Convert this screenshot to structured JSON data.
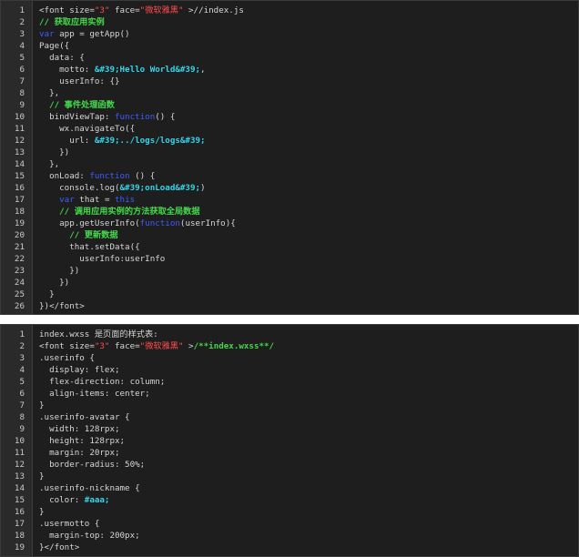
{
  "blocks": [
    {
      "id": "index-js",
      "lines": [
        {
          "n": "1",
          "tokens": [
            {
              "t": "<font size=",
              "c": "plain"
            },
            {
              "t": "\"3\"",
              "c": "str"
            },
            {
              "t": " face=",
              "c": "plain"
            },
            {
              "t": "\"微软雅黑\"",
              "c": "str"
            },
            {
              "t": " >//index.js",
              "c": "plain"
            }
          ]
        },
        {
          "n": "2",
          "tokens": [
            {
              "t": "// 获取应用实例",
              "c": "com"
            }
          ]
        },
        {
          "n": "3",
          "tokens": [
            {
              "t": "var",
              "c": "kw"
            },
            {
              "t": " app = getApp()",
              "c": "plain"
            }
          ]
        },
        {
          "n": "4",
          "tokens": [
            {
              "t": "Page({",
              "c": "plain"
            }
          ]
        },
        {
          "n": "5",
          "tokens": [
            {
              "t": "  data: {",
              "c": "plain"
            }
          ]
        },
        {
          "n": "6",
          "tokens": [
            {
              "t": "    motto: ",
              "c": "plain"
            },
            {
              "t": "&#39;Hello World&#39;",
              "c": "bstr"
            },
            {
              "t": ",",
              "c": "plain"
            }
          ]
        },
        {
          "n": "7",
          "tokens": [
            {
              "t": "    userInfo: {}",
              "c": "plain"
            }
          ]
        },
        {
          "n": "8",
          "tokens": [
            {
              "t": "  },",
              "c": "plain"
            }
          ]
        },
        {
          "n": "9",
          "tokens": [
            {
              "t": "  // 事件处理函数",
              "c": "com"
            }
          ]
        },
        {
          "n": "10",
          "tokens": [
            {
              "t": "  bindViewTap: ",
              "c": "plain"
            },
            {
              "t": "function",
              "c": "kw"
            },
            {
              "t": "() {",
              "c": "plain"
            }
          ]
        },
        {
          "n": "11",
          "tokens": [
            {
              "t": "    wx.navigateTo({",
              "c": "plain"
            }
          ]
        },
        {
          "n": "12",
          "tokens": [
            {
              "t": "      url: ",
              "c": "plain"
            },
            {
              "t": "&#39;../logs/logs&#39;",
              "c": "bstr"
            }
          ]
        },
        {
          "n": "13",
          "tokens": [
            {
              "t": "    })",
              "c": "plain"
            }
          ]
        },
        {
          "n": "14",
          "tokens": [
            {
              "t": "  },",
              "c": "plain"
            }
          ]
        },
        {
          "n": "15",
          "tokens": [
            {
              "t": "  onLoad: ",
              "c": "plain"
            },
            {
              "t": "function",
              "c": "kw"
            },
            {
              "t": " () {",
              "c": "plain"
            }
          ]
        },
        {
          "n": "16",
          "tokens": [
            {
              "t": "    console.log(",
              "c": "plain"
            },
            {
              "t": "&#39;onLoad&#39;",
              "c": "bstr"
            },
            {
              "t": ")",
              "c": "plain"
            }
          ]
        },
        {
          "n": "17",
          "tokens": [
            {
              "t": "    ",
              "c": "plain"
            },
            {
              "t": "var",
              "c": "kw"
            },
            {
              "t": " that = ",
              "c": "plain"
            },
            {
              "t": "this",
              "c": "kw"
            }
          ]
        },
        {
          "n": "18",
          "tokens": [
            {
              "t": "    // 调用应用实例的方法获取全局数据",
              "c": "com"
            }
          ]
        },
        {
          "n": "19",
          "tokens": [
            {
              "t": "    app.getUserInfo(",
              "c": "plain"
            },
            {
              "t": "function",
              "c": "kw"
            },
            {
              "t": "(userInfo){",
              "c": "plain"
            }
          ]
        },
        {
          "n": "20",
          "tokens": [
            {
              "t": "      // 更新数据",
              "c": "com"
            }
          ]
        },
        {
          "n": "21",
          "tokens": [
            {
              "t": "      that.setData({",
              "c": "plain"
            }
          ]
        },
        {
          "n": "22",
          "tokens": [
            {
              "t": "        userInfo:userInfo",
              "c": "plain"
            }
          ]
        },
        {
          "n": "23",
          "tokens": [
            {
              "t": "      })",
              "c": "plain"
            }
          ]
        },
        {
          "n": "24",
          "tokens": [
            {
              "t": "    })",
              "c": "plain"
            }
          ]
        },
        {
          "n": "25",
          "tokens": [
            {
              "t": "  }",
              "c": "plain"
            }
          ]
        },
        {
          "n": "26",
          "tokens": [
            {
              "t": "})</font>",
              "c": "plain"
            }
          ]
        }
      ]
    },
    {
      "id": "index-wxss",
      "lines": [
        {
          "n": "1",
          "tokens": [
            {
              "t": "index.wxss 是页面的样式表:",
              "c": "plain"
            }
          ]
        },
        {
          "n": "2",
          "tokens": [
            {
              "t": "<font size=",
              "c": "plain"
            },
            {
              "t": "\"3\"",
              "c": "str"
            },
            {
              "t": " face=",
              "c": "plain"
            },
            {
              "t": "\"微软雅黑\"",
              "c": "str"
            },
            {
              "t": " >",
              "c": "plain"
            },
            {
              "t": "/**index.wxss**/",
              "c": "com"
            }
          ]
        },
        {
          "n": "3",
          "tokens": [
            {
              "t": ".userinfo {",
              "c": "plain"
            }
          ]
        },
        {
          "n": "4",
          "tokens": [
            {
              "t": "  display: flex;",
              "c": "plain"
            }
          ]
        },
        {
          "n": "5",
          "tokens": [
            {
              "t": "  flex-direction: column;",
              "c": "plain"
            }
          ]
        },
        {
          "n": "6",
          "tokens": [
            {
              "t": "  align-items: center;",
              "c": "plain"
            }
          ]
        },
        {
          "n": "7",
          "tokens": [
            {
              "t": "}",
              "c": "plain"
            }
          ]
        },
        {
          "n": "8",
          "tokens": [
            {
              "t": ".userinfo-avatar {",
              "c": "plain"
            }
          ]
        },
        {
          "n": "9",
          "tokens": [
            {
              "t": "  width: 128rpx;",
              "c": "plain"
            }
          ]
        },
        {
          "n": "10",
          "tokens": [
            {
              "t": "  height: 128rpx;",
              "c": "plain"
            }
          ]
        },
        {
          "n": "11",
          "tokens": [
            {
              "t": "  margin: 20rpx;",
              "c": "plain"
            }
          ]
        },
        {
          "n": "12",
          "tokens": [
            {
              "t": "  border-radius: 50%;",
              "c": "plain"
            }
          ]
        },
        {
          "n": "13",
          "tokens": [
            {
              "t": "}",
              "c": "plain"
            }
          ]
        },
        {
          "n": "14",
          "tokens": [
            {
              "t": ".userinfo-nickname {",
              "c": "plain"
            }
          ]
        },
        {
          "n": "15",
          "tokens": [
            {
              "t": "  color: ",
              "c": "plain"
            },
            {
              "t": "#aaa;",
              "c": "bstr"
            }
          ]
        },
        {
          "n": "16",
          "tokens": [
            {
              "t": "}",
              "c": "plain"
            }
          ]
        },
        {
          "n": "17",
          "tokens": [
            {
              "t": ".usermotto {",
              "c": "plain"
            }
          ]
        },
        {
          "n": "18",
          "tokens": [
            {
              "t": "  margin-top: 200px;",
              "c": "plain"
            }
          ]
        },
        {
          "n": "19",
          "tokens": [
            {
              "t": "}</font>",
              "c": "plain"
            }
          ]
        }
      ]
    }
  ],
  "colors": {
    "background": "#1e1e1e",
    "gutter": "#2a2a2a",
    "plain": "#d6d6d6",
    "string": "#ff4d4d",
    "keyword": "#3d5cff",
    "comment": "#43d84a",
    "literal": "#35d3e8"
  }
}
